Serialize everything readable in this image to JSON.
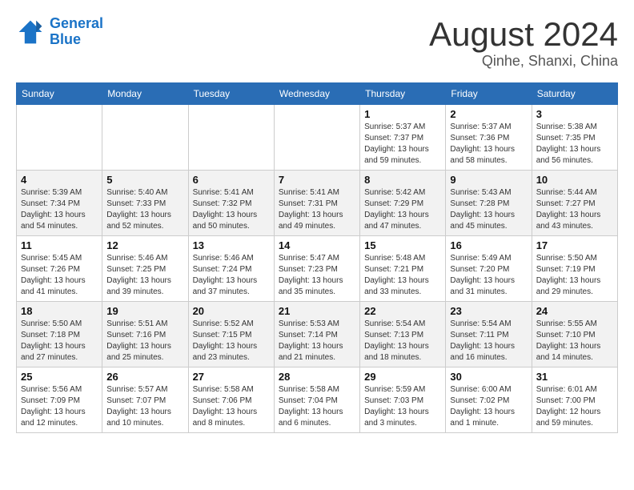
{
  "header": {
    "logo_line1": "General",
    "logo_line2": "Blue",
    "main_title": "August 2024",
    "subtitle": "Qinhe, Shanxi, China"
  },
  "calendar": {
    "days_of_week": [
      "Sunday",
      "Monday",
      "Tuesday",
      "Wednesday",
      "Thursday",
      "Friday",
      "Saturday"
    ],
    "weeks": [
      [
        {
          "day": "",
          "info": ""
        },
        {
          "day": "",
          "info": ""
        },
        {
          "day": "",
          "info": ""
        },
        {
          "day": "",
          "info": ""
        },
        {
          "day": "1",
          "info": "Sunrise: 5:37 AM\nSunset: 7:37 PM\nDaylight: 13 hours\nand 59 minutes."
        },
        {
          "day": "2",
          "info": "Sunrise: 5:37 AM\nSunset: 7:36 PM\nDaylight: 13 hours\nand 58 minutes."
        },
        {
          "day": "3",
          "info": "Sunrise: 5:38 AM\nSunset: 7:35 PM\nDaylight: 13 hours\nand 56 minutes."
        }
      ],
      [
        {
          "day": "4",
          "info": "Sunrise: 5:39 AM\nSunset: 7:34 PM\nDaylight: 13 hours\nand 54 minutes."
        },
        {
          "day": "5",
          "info": "Sunrise: 5:40 AM\nSunset: 7:33 PM\nDaylight: 13 hours\nand 52 minutes."
        },
        {
          "day": "6",
          "info": "Sunrise: 5:41 AM\nSunset: 7:32 PM\nDaylight: 13 hours\nand 50 minutes."
        },
        {
          "day": "7",
          "info": "Sunrise: 5:41 AM\nSunset: 7:31 PM\nDaylight: 13 hours\nand 49 minutes."
        },
        {
          "day": "8",
          "info": "Sunrise: 5:42 AM\nSunset: 7:29 PM\nDaylight: 13 hours\nand 47 minutes."
        },
        {
          "day": "9",
          "info": "Sunrise: 5:43 AM\nSunset: 7:28 PM\nDaylight: 13 hours\nand 45 minutes."
        },
        {
          "day": "10",
          "info": "Sunrise: 5:44 AM\nSunset: 7:27 PM\nDaylight: 13 hours\nand 43 minutes."
        }
      ],
      [
        {
          "day": "11",
          "info": "Sunrise: 5:45 AM\nSunset: 7:26 PM\nDaylight: 13 hours\nand 41 minutes."
        },
        {
          "day": "12",
          "info": "Sunrise: 5:46 AM\nSunset: 7:25 PM\nDaylight: 13 hours\nand 39 minutes."
        },
        {
          "day": "13",
          "info": "Sunrise: 5:46 AM\nSunset: 7:24 PM\nDaylight: 13 hours\nand 37 minutes."
        },
        {
          "day": "14",
          "info": "Sunrise: 5:47 AM\nSunset: 7:23 PM\nDaylight: 13 hours\nand 35 minutes."
        },
        {
          "day": "15",
          "info": "Sunrise: 5:48 AM\nSunset: 7:21 PM\nDaylight: 13 hours\nand 33 minutes."
        },
        {
          "day": "16",
          "info": "Sunrise: 5:49 AM\nSunset: 7:20 PM\nDaylight: 13 hours\nand 31 minutes."
        },
        {
          "day": "17",
          "info": "Sunrise: 5:50 AM\nSunset: 7:19 PM\nDaylight: 13 hours\nand 29 minutes."
        }
      ],
      [
        {
          "day": "18",
          "info": "Sunrise: 5:50 AM\nSunset: 7:18 PM\nDaylight: 13 hours\nand 27 minutes."
        },
        {
          "day": "19",
          "info": "Sunrise: 5:51 AM\nSunset: 7:16 PM\nDaylight: 13 hours\nand 25 minutes."
        },
        {
          "day": "20",
          "info": "Sunrise: 5:52 AM\nSunset: 7:15 PM\nDaylight: 13 hours\nand 23 minutes."
        },
        {
          "day": "21",
          "info": "Sunrise: 5:53 AM\nSunset: 7:14 PM\nDaylight: 13 hours\nand 21 minutes."
        },
        {
          "day": "22",
          "info": "Sunrise: 5:54 AM\nSunset: 7:13 PM\nDaylight: 13 hours\nand 18 minutes."
        },
        {
          "day": "23",
          "info": "Sunrise: 5:54 AM\nSunset: 7:11 PM\nDaylight: 13 hours\nand 16 minutes."
        },
        {
          "day": "24",
          "info": "Sunrise: 5:55 AM\nSunset: 7:10 PM\nDaylight: 13 hours\nand 14 minutes."
        }
      ],
      [
        {
          "day": "25",
          "info": "Sunrise: 5:56 AM\nSunset: 7:09 PM\nDaylight: 13 hours\nand 12 minutes."
        },
        {
          "day": "26",
          "info": "Sunrise: 5:57 AM\nSunset: 7:07 PM\nDaylight: 13 hours\nand 10 minutes."
        },
        {
          "day": "27",
          "info": "Sunrise: 5:58 AM\nSunset: 7:06 PM\nDaylight: 13 hours\nand 8 minutes."
        },
        {
          "day": "28",
          "info": "Sunrise: 5:58 AM\nSunset: 7:04 PM\nDaylight: 13 hours\nand 6 minutes."
        },
        {
          "day": "29",
          "info": "Sunrise: 5:59 AM\nSunset: 7:03 PM\nDaylight: 13 hours\nand 3 minutes."
        },
        {
          "day": "30",
          "info": "Sunrise: 6:00 AM\nSunset: 7:02 PM\nDaylight: 13 hours\nand 1 minute."
        },
        {
          "day": "31",
          "info": "Sunrise: 6:01 AM\nSunset: 7:00 PM\nDaylight: 12 hours\nand 59 minutes."
        }
      ]
    ]
  }
}
